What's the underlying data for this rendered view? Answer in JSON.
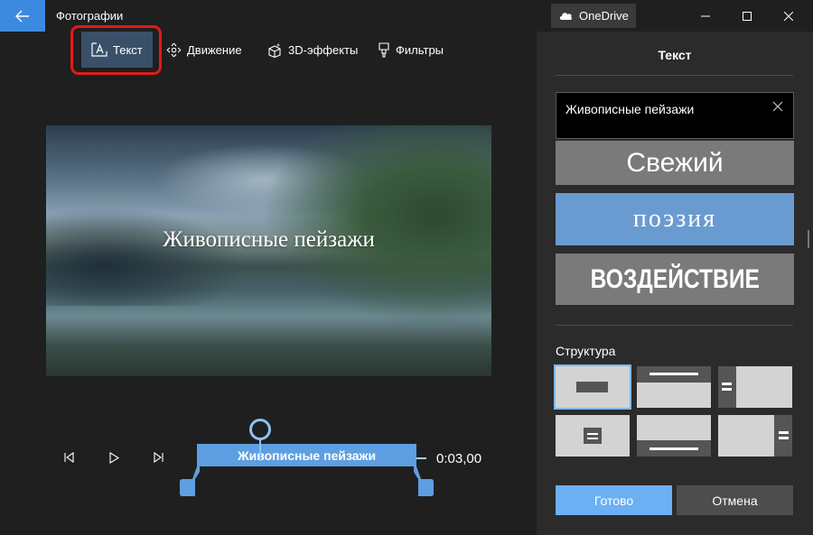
{
  "window": {
    "app_title": "Фотографии",
    "onedrive_label": "OneDrive",
    "accent": "#3c8ae0"
  },
  "toolbar": {
    "items": [
      {
        "label": "Текст",
        "icon": "text-box-icon",
        "selected": true
      },
      {
        "label": "Движение",
        "icon": "motion-icon",
        "selected": false
      },
      {
        "label": "3D-эффекты",
        "icon": "3d-effects-icon",
        "selected": false
      },
      {
        "label": "Фильтры",
        "icon": "filters-icon",
        "selected": false
      }
    ]
  },
  "preview": {
    "caption": "Живописные пейзажи"
  },
  "timeline": {
    "clip_label": "Живописные пейзажи",
    "time": "0:03,00"
  },
  "panel": {
    "title": "Текст",
    "text_value": "Живописные пейзажи",
    "styles": [
      "Свежий",
      "поэзия",
      "ВОЗДЕЙСТВИЕ"
    ],
    "layout_section_label": "Структура",
    "done_label": "Готово",
    "cancel_label": "Отмена"
  }
}
